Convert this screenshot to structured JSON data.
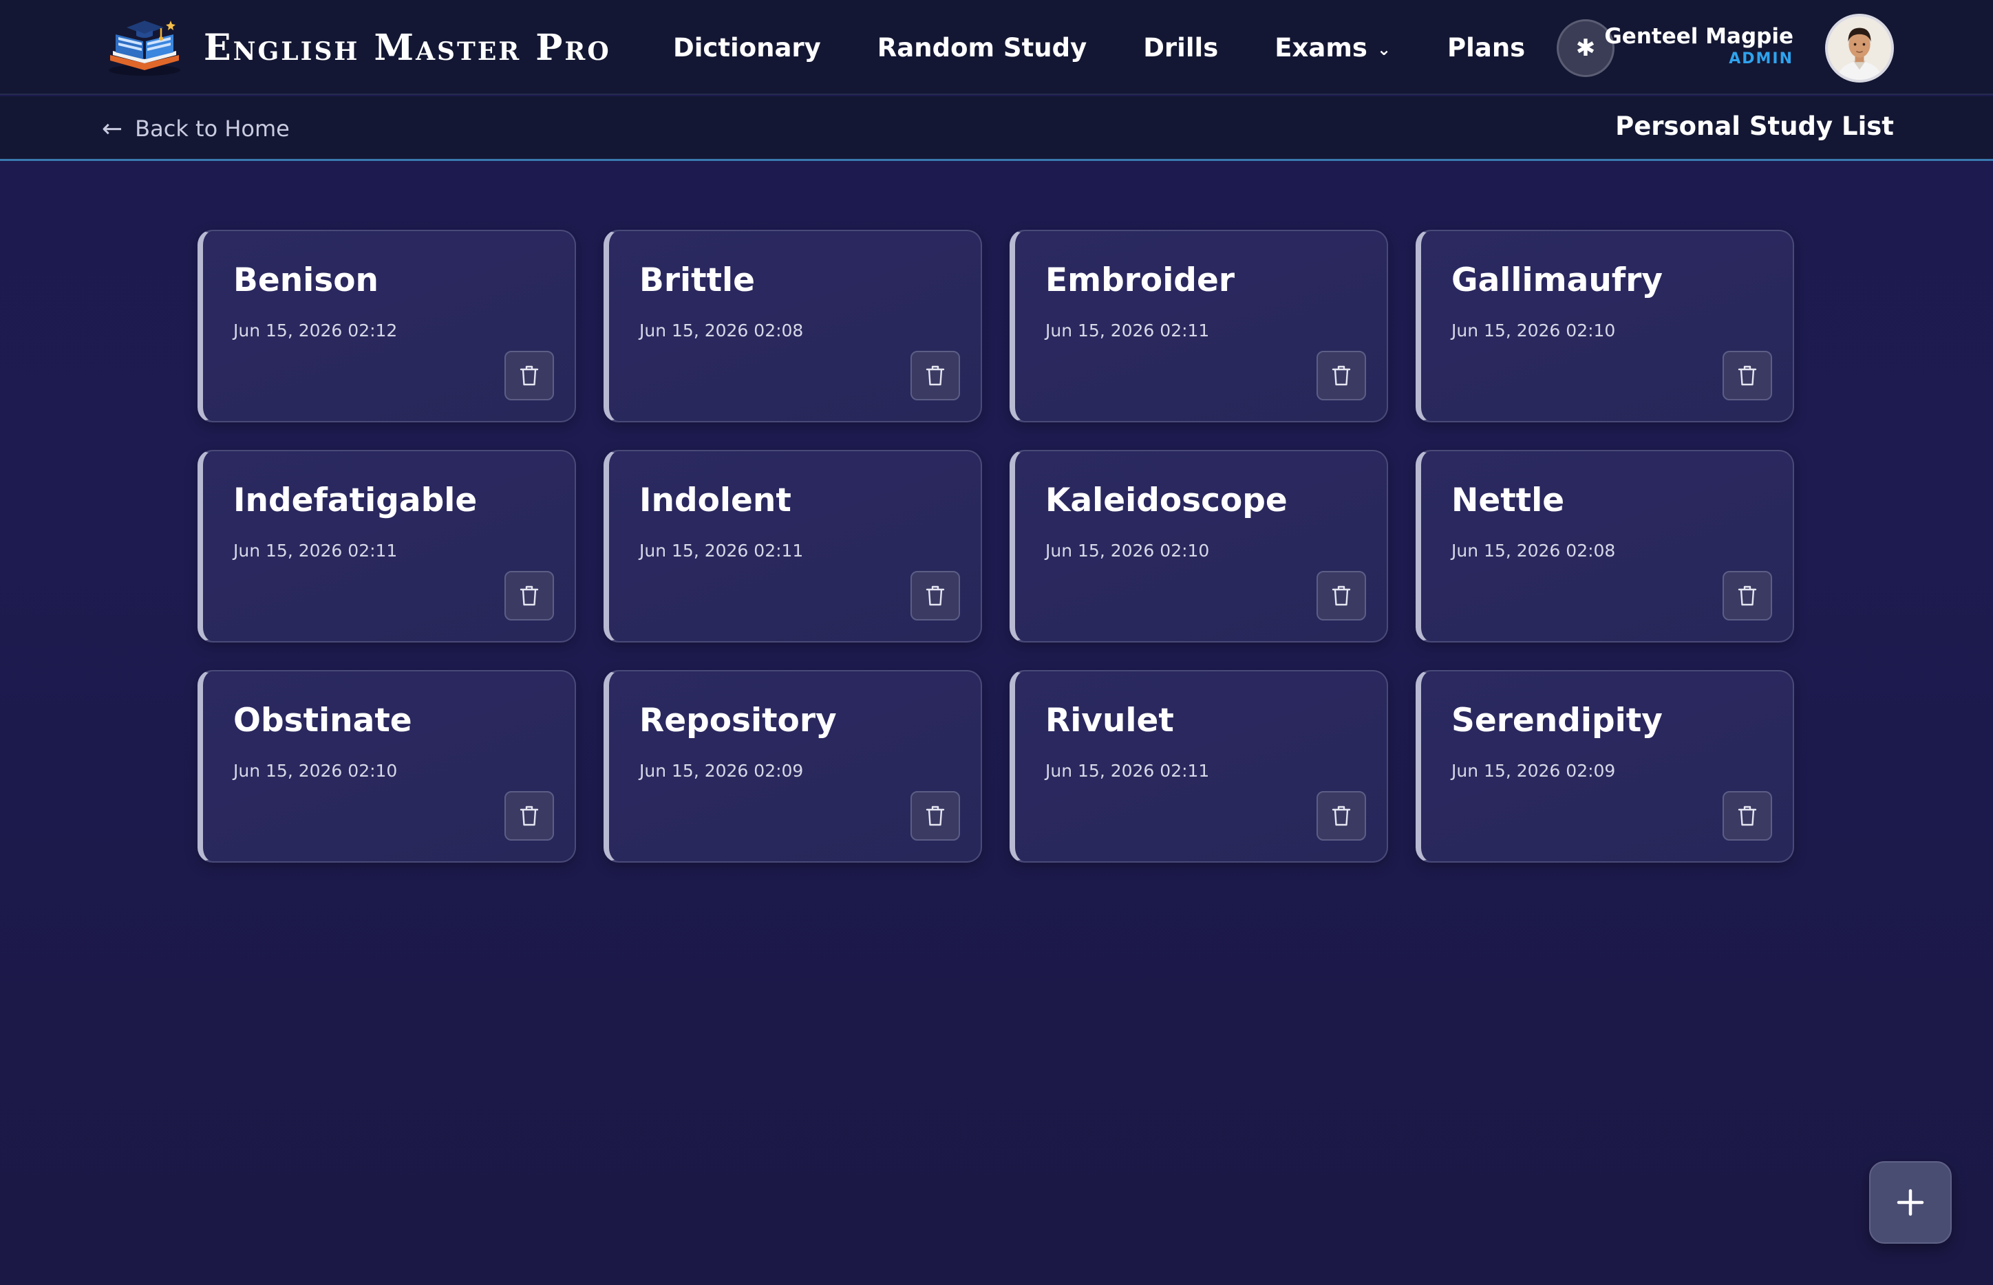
{
  "brand": {
    "name": "English Master Pro",
    "logo_icon": "books-logo-icon"
  },
  "nav": {
    "items": [
      {
        "label": "Dictionary"
      },
      {
        "label": "Random Study"
      },
      {
        "label": "Drills"
      },
      {
        "label": "Exams",
        "has_dropdown": true
      },
      {
        "label": "Plans"
      }
    ]
  },
  "header": {
    "theme_toggle_icon": "asterisk-icon",
    "theme_toggle_glyph": "✱",
    "user": {
      "name": "Genteel Magpie",
      "role": "ADMIN"
    }
  },
  "subbar": {
    "back_label": "Back to Home",
    "title": "Personal Study List"
  },
  "cards": [
    {
      "word": "Benison",
      "date": "Jun 15, 2026 02:12"
    },
    {
      "word": "Brittle",
      "date": "Jun 15, 2026 02:08"
    },
    {
      "word": "Embroider",
      "date": "Jun 15, 2026 02:11"
    },
    {
      "word": "Gallimaufry",
      "date": "Jun 15, 2026 02:10"
    },
    {
      "word": "Indefatigable",
      "date": "Jun 15, 2026 02:11"
    },
    {
      "word": "Indolent",
      "date": "Jun 15, 2026 02:11"
    },
    {
      "word": "Kaleidoscope",
      "date": "Jun 15, 2026 02:10"
    },
    {
      "word": "Nettle",
      "date": "Jun 15, 2026 02:08"
    },
    {
      "word": "Obstinate",
      "date": "Jun 15, 2026 02:10"
    },
    {
      "word": "Repository",
      "date": "Jun 15, 2026 02:09"
    },
    {
      "word": "Rivulet",
      "date": "Jun 15, 2026 02:11"
    },
    {
      "word": "Serendipity",
      "date": "Jun 15, 2026 02:09"
    }
  ],
  "colors": {
    "background": "#1d1b50",
    "topbar": "#141733",
    "accent_role": "#2fa3ee",
    "card": "#2b2960",
    "card_accent_border": "#b8b9d2"
  },
  "icons": {
    "delete": "trash-icon",
    "fab": "plus-icon",
    "back": "arrow-left-icon",
    "dropdown": "chevron-down-icon"
  }
}
